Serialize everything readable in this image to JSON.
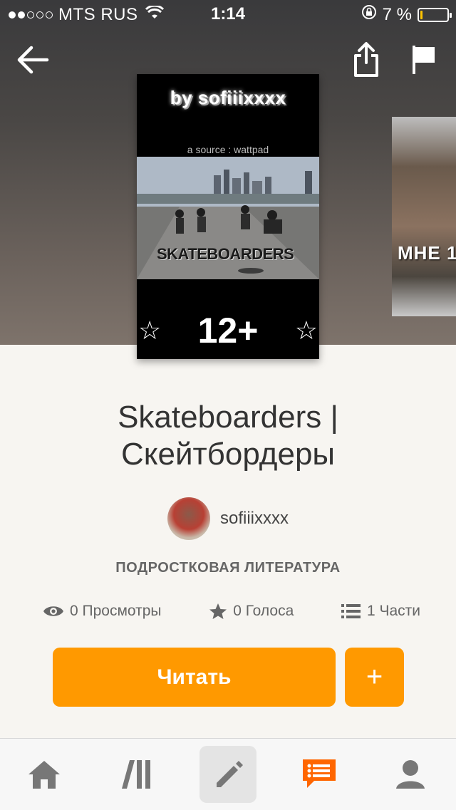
{
  "status_bar": {
    "carrier": "MTS RUS",
    "time": "1:14",
    "battery_percent": "7 %",
    "battery_level": 0.07,
    "signal_bars_filled": 2,
    "signal_bars_total": 5
  },
  "nav": {
    "back_icon": "back-arrow-icon",
    "share_icon": "share-icon",
    "report_icon": "flag-icon"
  },
  "cover": {
    "by_text": "by sofiiixxxx",
    "source_text": "a source : wattpad",
    "title_text": "SKATEBOARDERS",
    "age_text": "12+",
    "star_glyph": "☆"
  },
  "side_cover": {
    "text": "МНЕ 1"
  },
  "book": {
    "title_line1": "Skateboarders |",
    "title_line2": "Скейтбордеры",
    "author": "sofiiixxxx",
    "genre": "ПОДРОСТКОВАЯ ЛИТЕРАТУРА"
  },
  "stats": {
    "views": "0 Просмотры",
    "votes": "0 Голоса",
    "parts": "1 Части"
  },
  "actions": {
    "read_label": "Читать",
    "add_label": "+"
  },
  "tab_bar": {
    "tabs": [
      {
        "icon": "home-icon"
      },
      {
        "icon": "library-icon"
      },
      {
        "icon": "write-icon"
      },
      {
        "icon": "messages-icon"
      },
      {
        "icon": "profile-icon"
      }
    ],
    "active_index": 2
  },
  "colors": {
    "accent": "#ff9900",
    "background": "#f7f5f1"
  }
}
